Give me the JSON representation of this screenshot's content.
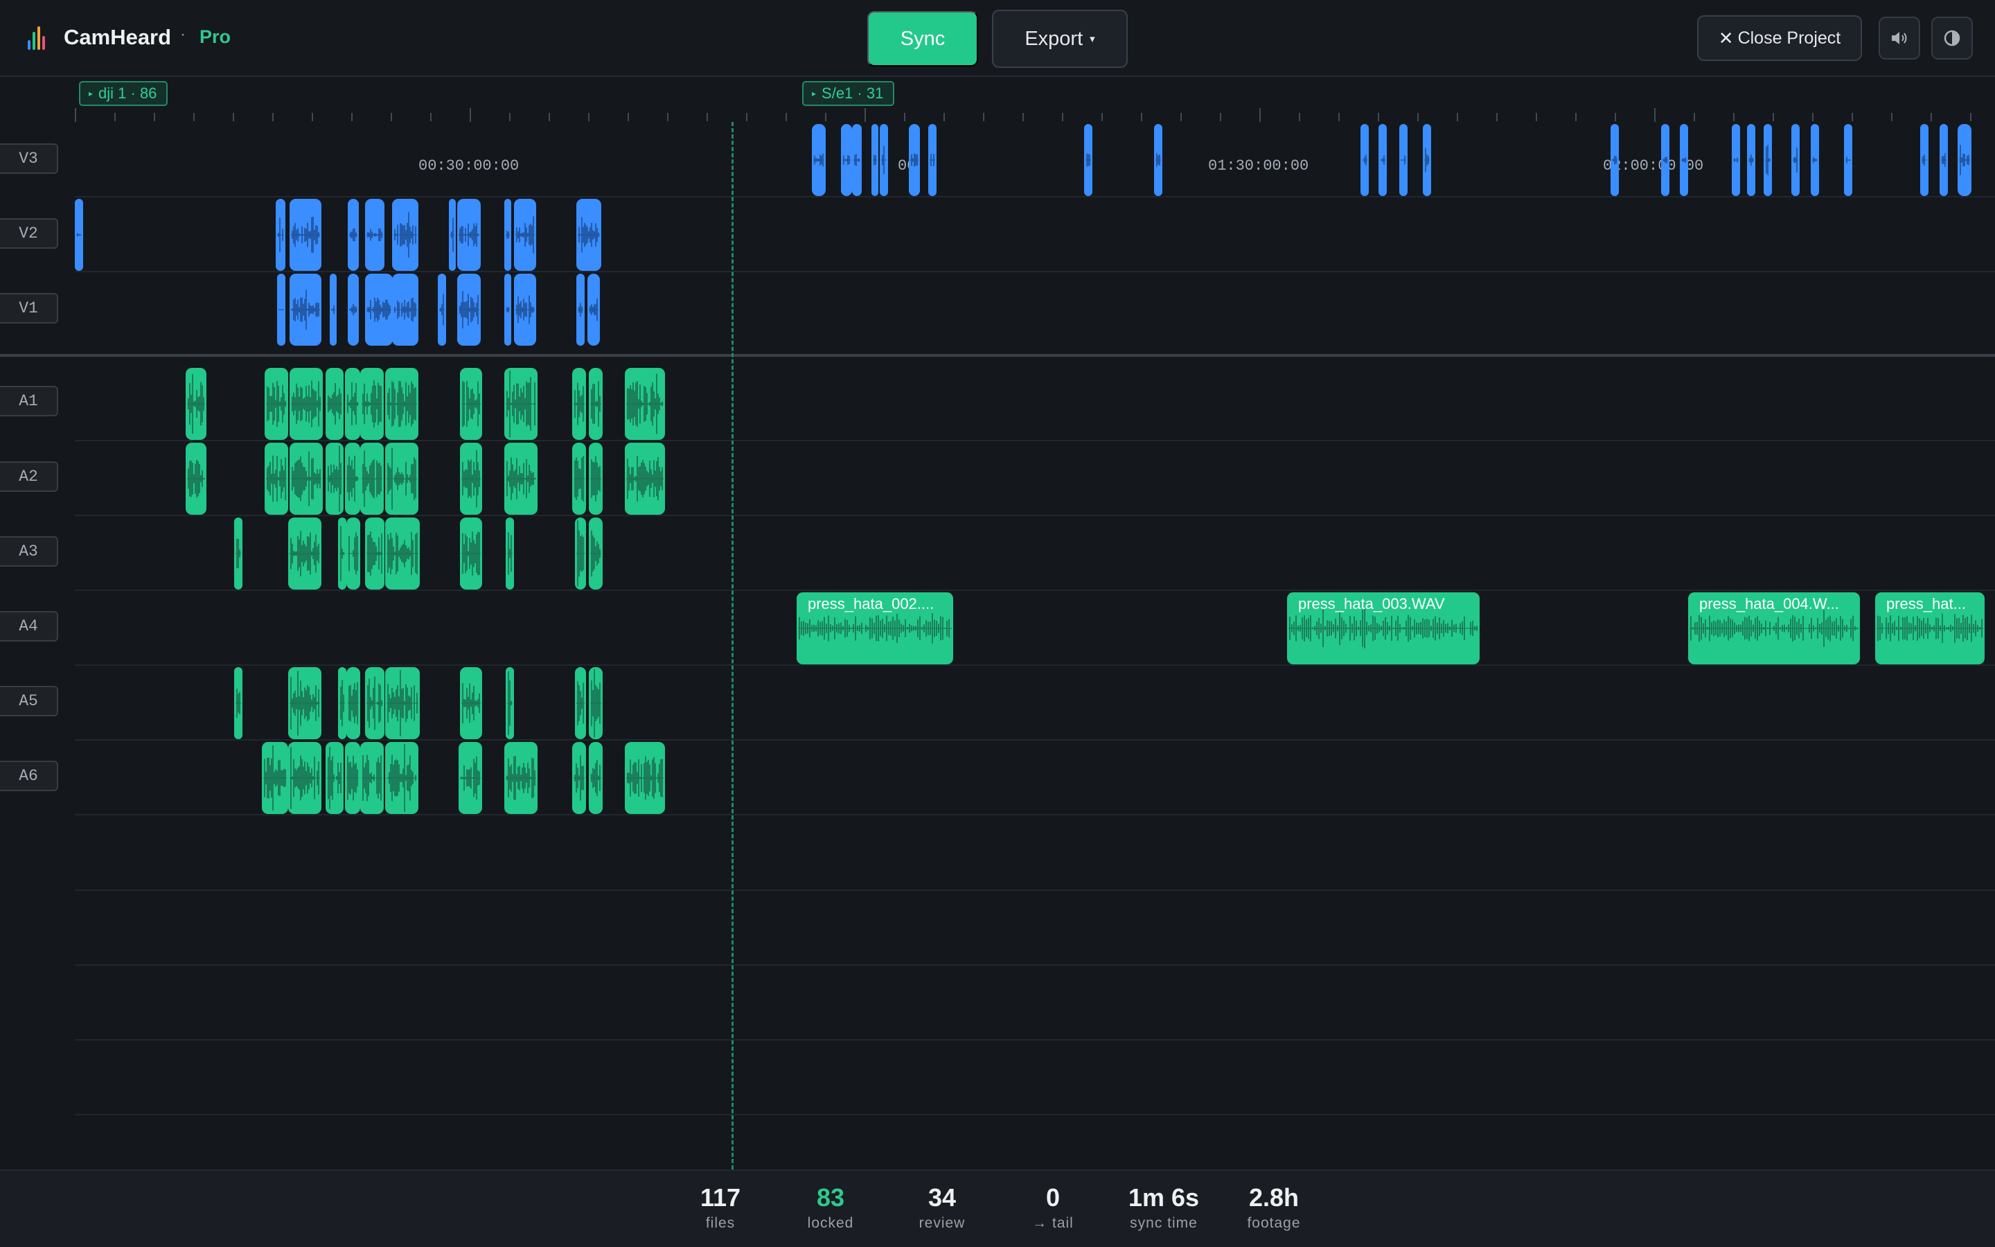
{
  "app": {
    "name": "CamHeard",
    "separator": "·",
    "tier": "Pro",
    "logo_colors": [
      "#3a8eff",
      "#22c98a",
      "#f2a33a",
      "#e05a7a"
    ]
  },
  "toolbar": {
    "sync_label": "Sync",
    "export_label": "Export",
    "export_caret": "▾",
    "close_icon": "✕",
    "close_label": "Close Project",
    "volume_icon": "speaker-icon",
    "theme_icon": "contrast-icon"
  },
  "ruler": {
    "timecodes": [
      "00:30:00:00",
      "00",
      "01:30:00:00",
      "02:00:00:00"
    ],
    "badges": [
      {
        "arrow": "▸",
        "label": "dji 1 · 86"
      },
      {
        "arrow": "▸",
        "label": "S/e1 · 31"
      }
    ]
  },
  "tracks": {
    "video": [
      "V3",
      "V2",
      "V1"
    ],
    "audio": [
      "A1",
      "A2",
      "A3",
      "A4",
      "A5",
      "A6"
    ]
  },
  "named_clips": [
    {
      "label": "press_hata_002...."
    },
    {
      "label": "press_hata_003.WAV"
    },
    {
      "label": "press_hata_004.W..."
    },
    {
      "label": "press_hat..."
    }
  ],
  "stats": [
    {
      "value": "117",
      "label": "files",
      "accent": false
    },
    {
      "value": "83",
      "label": "locked",
      "accent": true
    },
    {
      "value": "34",
      "label": "review",
      "accent": false
    },
    {
      "value": "0",
      "label": "→ tail",
      "accent": false
    },
    {
      "value": "1m 6s",
      "label": "sync time",
      "accent": false
    },
    {
      "value": "2.8h",
      "label": "footage",
      "accent": false
    }
  ],
  "colors": {
    "background": "#14171c",
    "video_clip": "#3a8eff",
    "audio_clip": "#22c98a",
    "accent": "#2ec98e",
    "waveform": "#1d6b50"
  }
}
